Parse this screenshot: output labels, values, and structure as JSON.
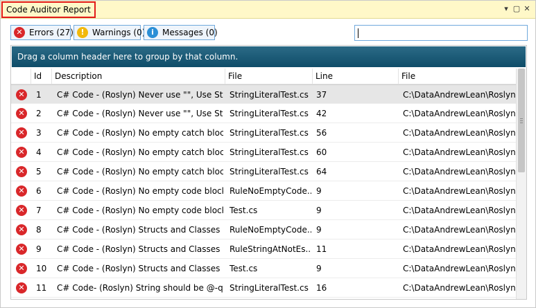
{
  "window": {
    "title": "Code Auditor Report",
    "pin_icon": "▾",
    "maximize_icon": "▢",
    "close_icon": "✕"
  },
  "toolbar": {
    "errors_label": "Errors (27)",
    "warnings_label": "Warnings (0)",
    "messages_label": "Messages (0)",
    "search_value": ""
  },
  "grid": {
    "group_panel_text": "Drag a column header here to group by that column.",
    "columns": [
      "Id",
      "Description",
      "File",
      "Line",
      "File"
    ],
    "rows": [
      {
        "id": "1",
        "description": "C# Code - (Roslyn) Never use \"\", Use String...",
        "file": "StringLiteralTest.cs",
        "line": "37",
        "path": "C:\\DataAndrewLean\\Roslyn..."
      },
      {
        "id": "2",
        "description": "C# Code - (Roslyn) Never use \"\", Use String...",
        "file": "StringLiteralTest.cs",
        "line": "42",
        "path": "C:\\DataAndrewLean\\Roslyn..."
      },
      {
        "id": "3",
        "description": "C# Code - (Roslyn) No empty catch blocks",
        "file": "StringLiteralTest.cs",
        "line": "56",
        "path": "C:\\DataAndrewLean\\Roslyn..."
      },
      {
        "id": "4",
        "description": "C# Code - (Roslyn) No empty catch blocks",
        "file": "StringLiteralTest.cs",
        "line": "60",
        "path": "C:\\DataAndrewLean\\Roslyn..."
      },
      {
        "id": "5",
        "description": "C# Code - (Roslyn) No empty catch blocks",
        "file": "StringLiteralTest.cs",
        "line": "64",
        "path": "C:\\DataAndrewLean\\Roslyn..."
      },
      {
        "id": "6",
        "description": "C# Code - (Roslyn) No empty code blocks",
        "file": "RuleNoEmptyCode...",
        "line": "9",
        "path": "C:\\DataAndrewLean\\Roslyn..."
      },
      {
        "id": "7",
        "description": "C# Code - (Roslyn) No empty code blocks",
        "file": "Test.cs",
        "line": "9",
        "path": "C:\\DataAndrewLean\\Roslyn..."
      },
      {
        "id": "8",
        "description": "C# Code - (Roslyn) Structs and Classes me...",
        "file": "RuleNoEmptyCode...",
        "line": "9",
        "path": "C:\\DataAndrewLean\\Roslyn..."
      },
      {
        "id": "9",
        "description": "C# Code - (Roslyn) Structs and Classes me...",
        "file": "RuleStringAtNotEs...",
        "line": "11",
        "path": "C:\\DataAndrewLean\\Roslyn..."
      },
      {
        "id": "10",
        "description": "C# Code - (Roslyn) Structs and Classes me...",
        "file": "Test.cs",
        "line": "9",
        "path": "C:\\DataAndrewLean\\Roslyn..."
      },
      {
        "id": "11",
        "description": "C# Code- (Roslyn) String should be @-quo...",
        "file": "StringLiteralTest.cs",
        "line": "16",
        "path": "C:\\DataAndrewLean\\Roslyn..."
      }
    ]
  },
  "colors": {
    "title_bar": "#fff8c8",
    "title_highlight": "#e21a1a",
    "error": "#d9272a",
    "warning": "#f2b90c",
    "info": "#2b8fd6",
    "group_panel": "#1a5a77"
  }
}
